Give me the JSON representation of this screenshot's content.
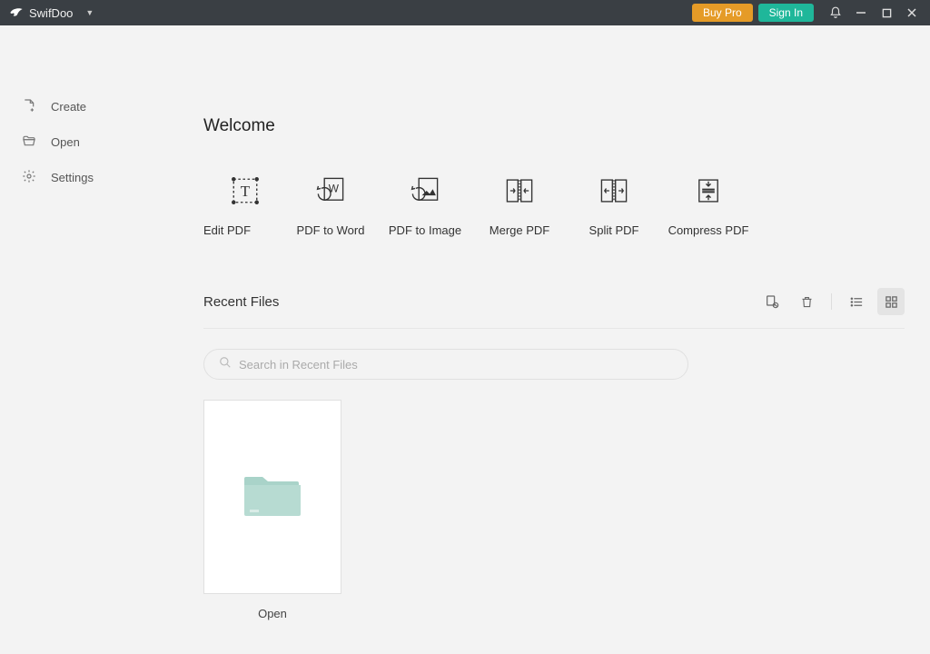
{
  "titlebar": {
    "app_name": "SwifDoo",
    "buy_label": "Buy Pro",
    "signin_label": "Sign In"
  },
  "sidebar": {
    "items": [
      {
        "label": "Create"
      },
      {
        "label": "Open"
      },
      {
        "label": "Settings"
      }
    ]
  },
  "content": {
    "welcome": "Welcome",
    "actions": [
      {
        "label": "Edit PDF"
      },
      {
        "label": "PDF to Word"
      },
      {
        "label": "PDF to Image"
      },
      {
        "label": "Merge PDF"
      },
      {
        "label": "Split PDF"
      },
      {
        "label": "Compress PDF"
      }
    ],
    "recent_title": "Recent Files",
    "search_placeholder": "Search in Recent Files",
    "open_card_label": "Open"
  }
}
